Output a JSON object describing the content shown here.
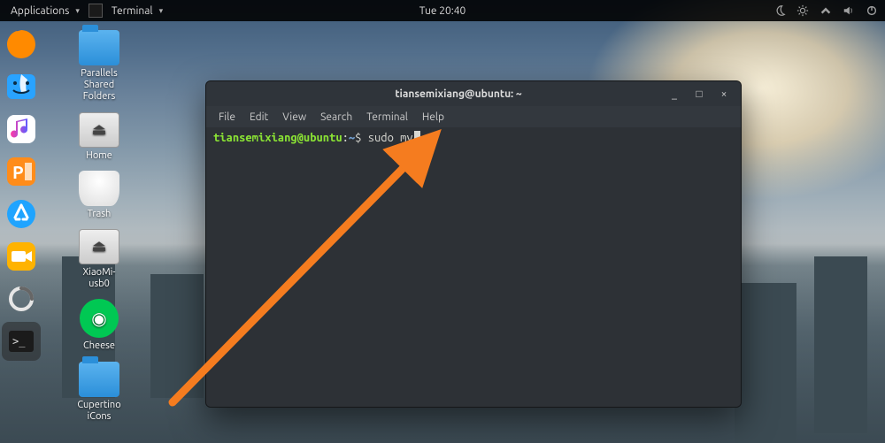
{
  "panel": {
    "applications_label": "Applications",
    "active_app_label": "Terminal",
    "clock": "Tue 20:40"
  },
  "desktop_icons": [
    {
      "id": "parallels-shared",
      "label": "Parallels\nShared\nFolders",
      "kind": "folder"
    },
    {
      "id": "home",
      "label": "Home",
      "kind": "drive"
    },
    {
      "id": "trash",
      "label": "Trash",
      "kind": "trash"
    },
    {
      "id": "xiaomi-usb",
      "label": "XiaoMi-\nusb0",
      "kind": "drive"
    },
    {
      "id": "cheese",
      "label": "Cheese",
      "kind": "cam"
    },
    {
      "id": "cupertino-icons",
      "label": "Cupertino\niCons",
      "kind": "folder"
    }
  ],
  "dock": [
    {
      "id": "firefox",
      "name": "firefox-icon"
    },
    {
      "id": "finder",
      "name": "finder-icon"
    },
    {
      "id": "music",
      "name": "music-icon"
    },
    {
      "id": "pages",
      "name": "pages-icon"
    },
    {
      "id": "appstore",
      "name": "appstore-icon"
    },
    {
      "id": "camera",
      "name": "camera-icon"
    },
    {
      "id": "loading",
      "name": "spinner-icon"
    },
    {
      "id": "terminal",
      "name": "terminal-launcher-icon"
    }
  ],
  "terminal": {
    "title": "tiansemixiang@ubuntu: ~",
    "menu": [
      "File",
      "Edit",
      "View",
      "Search",
      "Terminal",
      "Help"
    ],
    "prompt": {
      "user_host": "tiansemixiang@ubuntu",
      "sep": ":",
      "path": "~",
      "symbol": "$"
    },
    "command": "sudo mv",
    "window_controls": {
      "min": "_",
      "max": "□",
      "close": "×"
    }
  },
  "annotation_color": "#f57c1f"
}
